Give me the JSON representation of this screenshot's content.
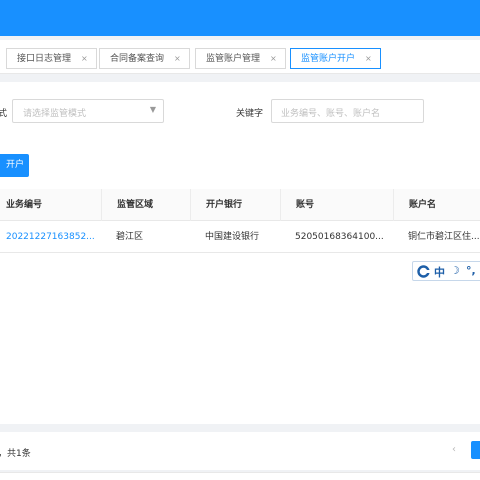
{
  "tabs": [
    {
      "label": "接口日志管理",
      "close": "×"
    },
    {
      "label": "合同备案查询",
      "close": "×"
    },
    {
      "label": "监管账户管理",
      "close": "×"
    },
    {
      "label": "监管账户开户",
      "close": "×"
    }
  ],
  "filters": {
    "mode_label_partial": "式",
    "mode_placeholder": "请选择监管模式",
    "keyword_label": "关键字",
    "keyword_placeholder": "业务编号、账号、账户名"
  },
  "actions": {
    "open_account_label": "开户"
  },
  "table": {
    "columns": [
      "业务编号",
      "监管区域",
      "开户银行",
      "账号",
      "账户名"
    ],
    "rows": [
      [
        "20221227163852...",
        "碧江区",
        "中国建设银行",
        "52050168364100...",
        "铜仁市碧江区住..."
      ]
    ]
  },
  "ime": {
    "mode": "中",
    "moon": "☽",
    "punct": "°,"
  },
  "pagination": {
    "total_text": "，共1条",
    "prev": "‹"
  },
  "colors": {
    "primary": "#1890ff",
    "border": "#d9d9d9"
  }
}
